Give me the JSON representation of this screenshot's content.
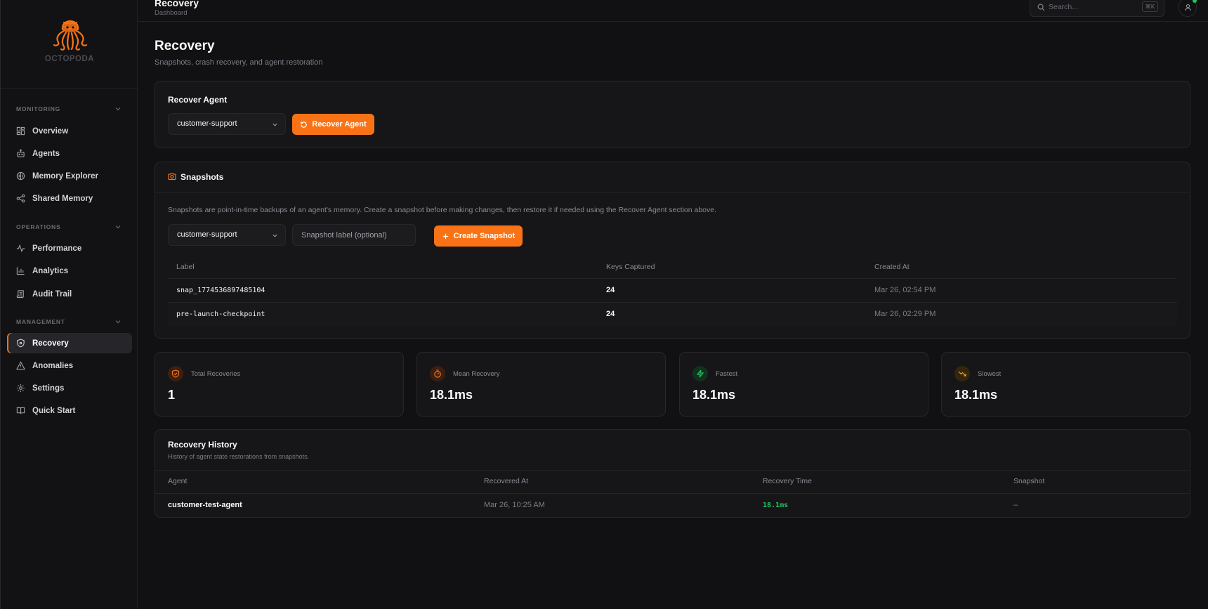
{
  "app": {
    "brand": "OCTOPODA"
  },
  "colors": {
    "accent": "#f97316",
    "success": "#22c55e"
  },
  "topbar": {
    "title": "Recovery",
    "breadcrumb": "Dashboard",
    "search_placeholder": "Search...",
    "shortcut": "⌘K"
  },
  "sidebar": {
    "sections": [
      {
        "title": "MONITORING",
        "items": [
          {
            "label": "Overview",
            "icon": "layout-dashboard-icon"
          },
          {
            "label": "Agents",
            "icon": "bot-icon"
          },
          {
            "label": "Memory Explorer",
            "icon": "brain-icon"
          },
          {
            "label": "Shared Memory",
            "icon": "share-icon"
          }
        ]
      },
      {
        "title": "OPERATIONS",
        "items": [
          {
            "label": "Performance",
            "icon": "activity-icon"
          },
          {
            "label": "Analytics",
            "icon": "bar-chart-icon"
          },
          {
            "label": "Audit Trail",
            "icon": "scroll-icon"
          }
        ]
      },
      {
        "title": "MANAGEMENT",
        "items": [
          {
            "label": "Recovery",
            "icon": "shield-icon",
            "active": true
          },
          {
            "label": "Anomalies",
            "icon": "alert-triangle-icon"
          },
          {
            "label": "Settings",
            "icon": "gear-icon"
          },
          {
            "label": "Quick Start",
            "icon": "book-icon"
          }
        ]
      }
    ]
  },
  "page": {
    "title": "Recovery",
    "subtitle": "Snapshots, crash recovery, and agent restoration"
  },
  "recover": {
    "title": "Recover Agent",
    "selected_agent": "customer-support",
    "button": "Recover Agent"
  },
  "snapshots": {
    "title": "Snapshots",
    "description": "Snapshots are point-in-time backups of an agent's memory. Create a snapshot before making changes, then restore it if needed using the Recover Agent section above.",
    "selected_agent": "customer-support",
    "label_placeholder": "Snapshot label (optional)",
    "create_button": "Create Snapshot",
    "columns": [
      "Label",
      "Keys Captured",
      "Created At"
    ],
    "rows": [
      {
        "label": "snap_1774536897485104",
        "keys": "24",
        "created": "Mar 26, 02:54 PM"
      },
      {
        "label": "pre-launch-checkpoint",
        "keys": "24",
        "created": "Mar 26, 02:29 PM"
      }
    ]
  },
  "stats": [
    {
      "label": "Total Recoveries",
      "value": "1",
      "icon": "shield-check-icon",
      "color": "#f97316"
    },
    {
      "label": "Mean Recovery",
      "value": "18.1ms",
      "icon": "timer-icon",
      "color": "#f97316"
    },
    {
      "label": "Fastest",
      "value": "18.1ms",
      "icon": "zap-icon",
      "color": "#22c55e"
    },
    {
      "label": "Slowest",
      "value": "18.1ms",
      "icon": "trending-down-icon",
      "color": "#f59e0b"
    }
  ],
  "history": {
    "title": "Recovery History",
    "subtitle": "History of agent state restorations from snapshots.",
    "columns": [
      "Agent",
      "Recovered At",
      "Recovery Time",
      "Snapshot"
    ],
    "rows": [
      {
        "agent": "customer-test-agent",
        "recovered_at": "Mar 26, 10:25 AM",
        "time": "18.1ms",
        "snapshot": "–"
      }
    ]
  }
}
